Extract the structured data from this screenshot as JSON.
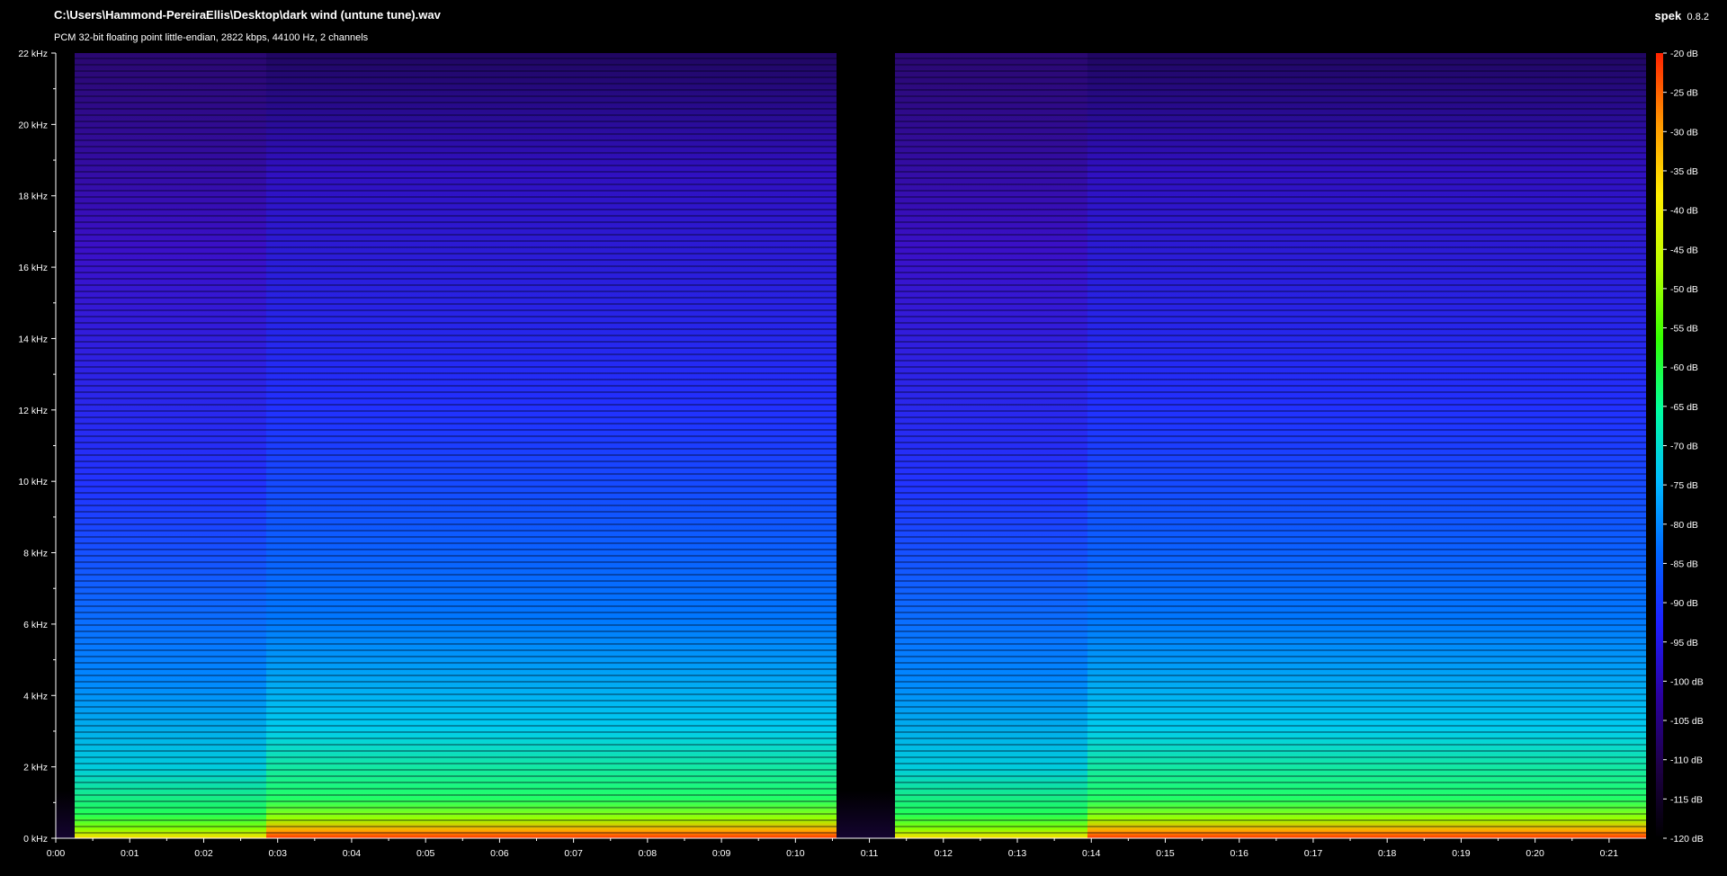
{
  "window": {
    "title": "C:\\Users\\Hammond-PereiraEllis\\Desktop\\dark wind (untune tune).wav",
    "subtitle": "PCM 32-bit floating point little-endian, 2822 kbps, 44100 Hz, 2 channels",
    "app_name": "spek",
    "app_version": "0.8.2"
  },
  "spectrogram": {
    "frequency_axis": {
      "labels": [
        "22 kHz",
        "20 kHz",
        "18 kHz",
        "16 kHz",
        "14 kHz",
        "12 kHz",
        "10 kHz",
        "8 kHz",
        "6 kHz",
        "4 kHz",
        "2 kHz",
        "0 kHz"
      ],
      "values_khz": [
        22,
        20,
        18,
        16,
        14,
        12,
        10,
        8,
        6,
        4,
        2,
        0
      ]
    },
    "time_axis": {
      "labels": [
        "0:00",
        "0:01",
        "0:02",
        "0:03",
        "0:04",
        "0:05",
        "0:06",
        "0:07",
        "0:08",
        "0:09",
        "0:10",
        "0:11",
        "0:12",
        "0:13",
        "0:14",
        "0:15",
        "0:16",
        "0:17",
        "0:18",
        "0:19",
        "0:20",
        "0:21"
      ],
      "values_s": [
        0,
        1,
        2,
        3,
        4,
        5,
        6,
        7,
        8,
        9,
        10,
        11,
        12,
        13,
        14,
        15,
        16,
        17,
        18,
        19,
        20,
        21
      ],
      "range_s": [
        0,
        21.5
      ]
    },
    "color_scale": {
      "labels": [
        "-20 dB",
        "-25 dB",
        "-30 dB",
        "-35 dB",
        "-40 dB",
        "-45 dB",
        "-50 dB",
        "-55 dB",
        "-60 dB",
        "-65 dB",
        "-70 dB",
        "-75 dB",
        "-80 dB",
        "-85 dB",
        "-90 dB",
        "-95 dB",
        "-100 dB",
        "-105 dB",
        "-110 dB",
        "-115 dB",
        "-120 dB"
      ],
      "range_db": [
        -120,
        -20
      ],
      "colors": [
        "#000000",
        "#1e0046",
        "#2a00a0",
        "#1e1eff",
        "#0066ff",
        "#00bbff",
        "#00ffa0",
        "#33ff00",
        "#bbff00",
        "#ffee00",
        "#ff9900",
        "#ff2200"
      ]
    },
    "regions": [
      {
        "start_s": 0.0,
        "end_s": 0.25,
        "kind": "silence"
      },
      {
        "start_s": 0.25,
        "end_s": 2.85,
        "kind": "signal"
      },
      {
        "start_s": 2.85,
        "end_s": 10.55,
        "kind": "signal-bright"
      },
      {
        "start_s": 10.55,
        "end_s": 11.35,
        "kind": "silence"
      },
      {
        "start_s": 11.35,
        "end_s": 13.95,
        "kind": "signal"
      },
      {
        "start_s": 13.95,
        "end_s": 21.5,
        "kind": "signal-bright"
      }
    ]
  }
}
